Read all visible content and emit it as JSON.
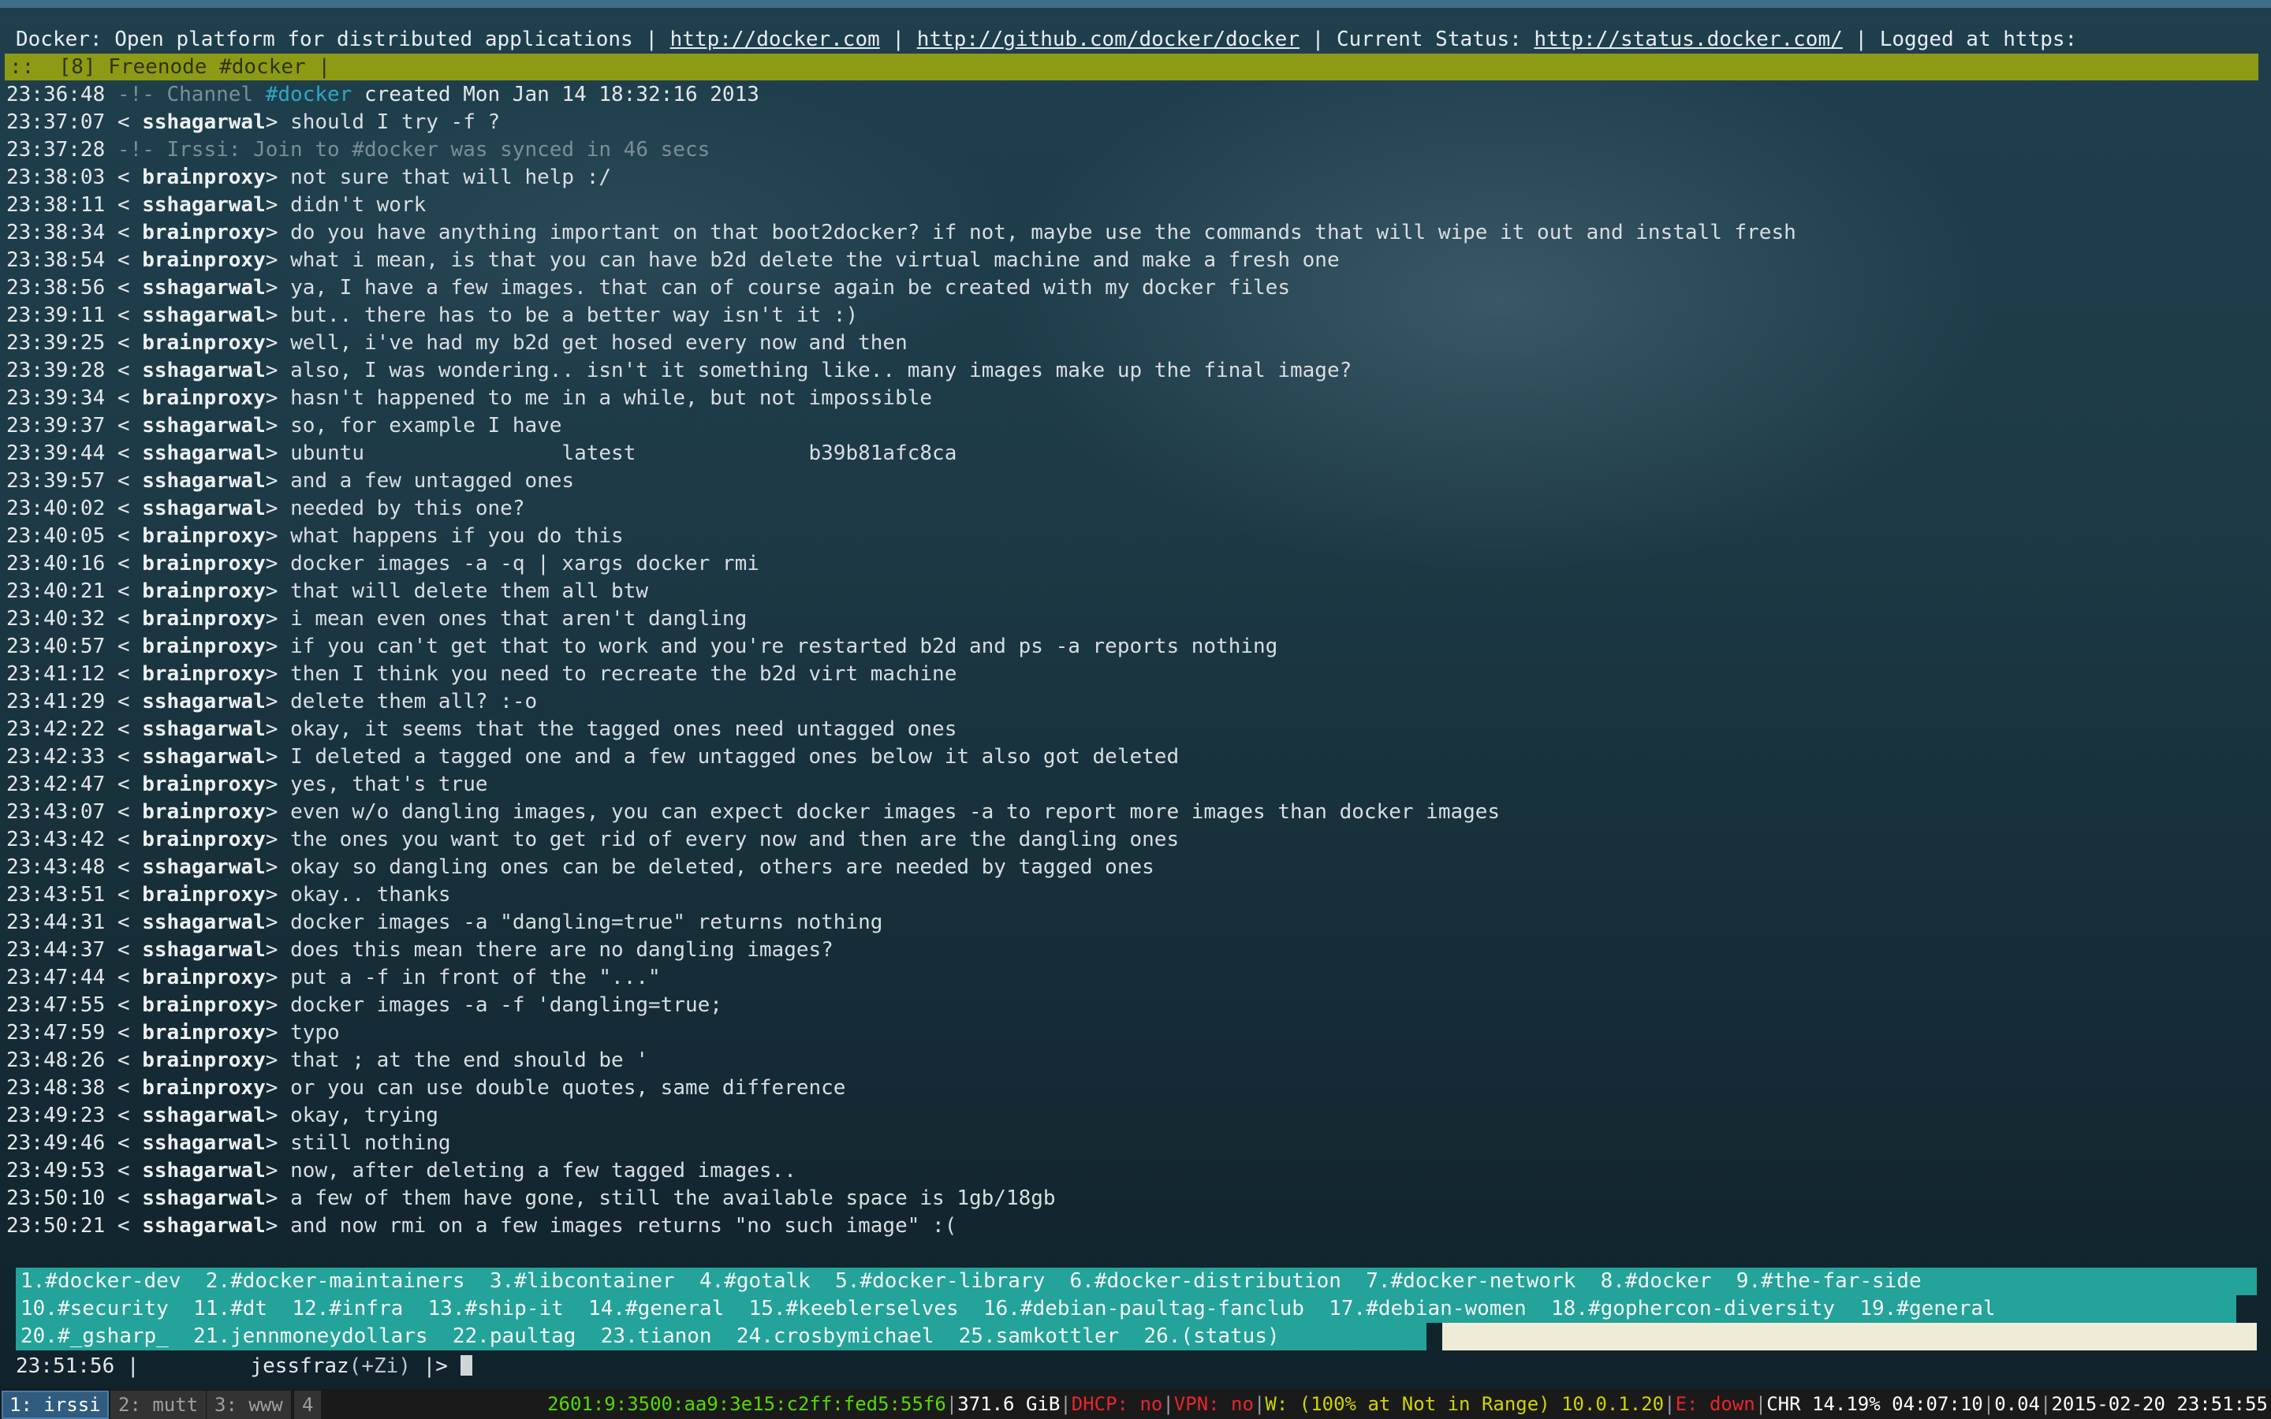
{
  "topic": {
    "channel_desc": "Docker: Open platform for distributed applications",
    "sep": "|",
    "link1": "http://docker.com",
    "link2": "http://github.com/docker/docker",
    "status_label": "Current Status:",
    "link3": "http://status.docker.com/",
    "logged": "Logged at https:"
  },
  "window_bar": {
    "text": "::  [8] Freenode #docker |"
  },
  "messages": [
    {
      "ts": "23:36:48",
      "type": "sys",
      "pre": " -!- Channel ",
      "chan": "#docker",
      "post": " created Mon Jan 14 18:32:16 2013"
    },
    {
      "ts": "23:37:07",
      "nick": "sshagarwal",
      "text": "should I try -f ?"
    },
    {
      "ts": "23:37:28",
      "type": "sys2",
      "text": " -!- Irssi: Join to #docker was synced in 46 secs"
    },
    {
      "ts": "23:38:03",
      "nick": "brainproxy",
      "text": "not sure that will help :/"
    },
    {
      "ts": "23:38:11",
      "nick": "sshagarwal",
      "text": "didn't work"
    },
    {
      "ts": "23:38:34",
      "nick": "brainproxy",
      "text": "do you have anything important on that boot2docker? if not, maybe use the commands that will wipe it out and install fresh"
    },
    {
      "ts": "23:38:54",
      "nick": "brainproxy",
      "text": "what i mean, is that you can have b2d delete the virtual machine and make a fresh one"
    },
    {
      "ts": "23:38:56",
      "nick": "sshagarwal",
      "text": "ya, I have a few images. that can of course again be created with my docker files"
    },
    {
      "ts": "23:39:11",
      "nick": "sshagarwal",
      "text": "but.. there has to be a better way isn't it :)"
    },
    {
      "ts": "23:39:25",
      "nick": "brainproxy",
      "text": "well, i've had my b2d get hosed every now and then"
    },
    {
      "ts": "23:39:28",
      "nick": "sshagarwal",
      "text": "also, I was wondering.. isn't it something like.. many images make up the final image?"
    },
    {
      "ts": "23:39:34",
      "nick": "brainproxy",
      "text": "hasn't happened to me in a while, but not impossible"
    },
    {
      "ts": "23:39:37",
      "nick": "sshagarwal",
      "text": "so, for example I have"
    },
    {
      "ts": "23:39:44",
      "nick": "sshagarwal",
      "text": "ubuntu                latest              b39b81afc8ca"
    },
    {
      "ts": "23:39:57",
      "nick": "sshagarwal",
      "text": "and a few untagged ones"
    },
    {
      "ts": "23:40:02",
      "nick": "sshagarwal",
      "text": "needed by this one?"
    },
    {
      "ts": "23:40:05",
      "nick": "brainproxy",
      "text": "what happens if you do this"
    },
    {
      "ts": "23:40:16",
      "nick": "brainproxy",
      "text": "docker images -a -q | xargs docker rmi"
    },
    {
      "ts": "23:40:21",
      "nick": "brainproxy",
      "text": "that will delete them all btw"
    },
    {
      "ts": "23:40:32",
      "nick": "brainproxy",
      "text": "i mean even ones that aren't dangling"
    },
    {
      "ts": "23:40:57",
      "nick": "brainproxy",
      "text": "if you can't get that to work and you're restarted b2d and ps -a reports nothing"
    },
    {
      "ts": "23:41:12",
      "nick": "brainproxy",
      "text": "then I think you need to recreate the b2d virt machine"
    },
    {
      "ts": "23:41:29",
      "nick": "sshagarwal",
      "text": "delete them all? :-o"
    },
    {
      "ts": "23:42:22",
      "nick": "sshagarwal",
      "text": "okay, it seems that the tagged ones need untagged ones"
    },
    {
      "ts": "23:42:33",
      "nick": "sshagarwal",
      "text": "I deleted a tagged one and a few untagged ones below it also got deleted"
    },
    {
      "ts": "23:42:47",
      "nick": "brainproxy",
      "text": "yes, that's true"
    },
    {
      "ts": "23:43:07",
      "nick": "brainproxy",
      "text": "even w/o dangling images, you can expect docker images -a to report more images than docker images"
    },
    {
      "ts": "23:43:42",
      "nick": "brainproxy",
      "text": "the ones you want to get rid of every now and then are the dangling ones"
    },
    {
      "ts": "23:43:48",
      "nick": "sshagarwal",
      "text": "okay so dangling ones can be deleted, others are needed by tagged ones"
    },
    {
      "ts": "23:43:51",
      "nick": "brainproxy",
      "text": "okay.. thanks"
    },
    {
      "ts": "23:44:31",
      "nick": "sshagarwal",
      "text": "docker images -a \"dangling=true\" returns nothing"
    },
    {
      "ts": "23:44:37",
      "nick": "sshagarwal",
      "text": "does this mean there are no dangling images?"
    },
    {
      "ts": "23:47:44",
      "nick": "brainproxy",
      "text": "put a -f in front of the \"...\""
    },
    {
      "ts": "23:47:55",
      "nick": "brainproxy",
      "text": "docker images -a -f 'dangling=true;"
    },
    {
      "ts": "23:47:59",
      "nick": "brainproxy",
      "text": "typo"
    },
    {
      "ts": "23:48:26",
      "nick": "brainproxy",
      "text": "that ; at the end should be '"
    },
    {
      "ts": "23:48:38",
      "nick": "brainproxy",
      "text": "or you can use double quotes, same difference"
    },
    {
      "ts": "23:49:23",
      "nick": "sshagarwal",
      "text": "okay, trying"
    },
    {
      "ts": "23:49:46",
      "nick": "sshagarwal",
      "text": "still nothing"
    },
    {
      "ts": "23:49:53",
      "nick": "sshagarwal",
      "text": "now, after deleting a few tagged images.."
    },
    {
      "ts": "23:50:10",
      "nick": "sshagarwal",
      "text": "a few of them have gone, still the available space is 1gb/18gb"
    },
    {
      "ts": "23:50:21",
      "nick": "sshagarwal",
      "text": "and now rmi on a few images returns \"no such image\" :("
    }
  ],
  "activity": {
    "row1": "1.#docker-dev  2.#docker-maintainers  3.#libcontainer  4.#gotalk  5.#docker-library  6.#docker-distribution  7.#docker-network  8.#docker  9.#the-far-side",
    "row2": "10.#security  11.#dt  12.#infra  13.#ship-it  14.#general  15.#keeblerselves  16.#debian-paultag-fanclub  17.#debian-women  18.#gophercon-diversity  19.#general",
    "row3": "20.#_gsharp_  21.jennmoneydollars  22.paultag  23.tianon  24.crosbymichael  25.samkottler  26.(status)"
  },
  "prompt": {
    "time": "23:51:56",
    "sep": "|",
    "nick": "jessfraz",
    "mode": "(+Zi)",
    "tail": "|>"
  },
  "workspaces": [
    {
      "label": "1: irssi",
      "active": true
    },
    {
      "label": "2: mutt",
      "active": false
    },
    {
      "label": "3: www",
      "active": false
    },
    {
      "label": "4",
      "active": false
    }
  ],
  "status": {
    "ipv6": "2601:9:3500:aa9:3e15:c2ff:fed5:55f6",
    "disk": "371.6 GiB",
    "dhcp": "DHCP: no",
    "vpn": "VPN: no",
    "wifi": "W: (100% at Not in Range) 10.0.1.20",
    "eth": "E: down",
    "battery": "CHR 14.19% 04:07:10",
    "load": "0.04",
    "datetime": "2015-02-20 23:51:55"
  },
  "colors": {
    "window_bar": "#8d9a15",
    "activity_bar": "#23a39a",
    "channel_highlight": "#2fa9bf",
    "status_ok": "#55d900",
    "status_bad": "#e8262b",
    "active_workspace": "#305c80"
  }
}
